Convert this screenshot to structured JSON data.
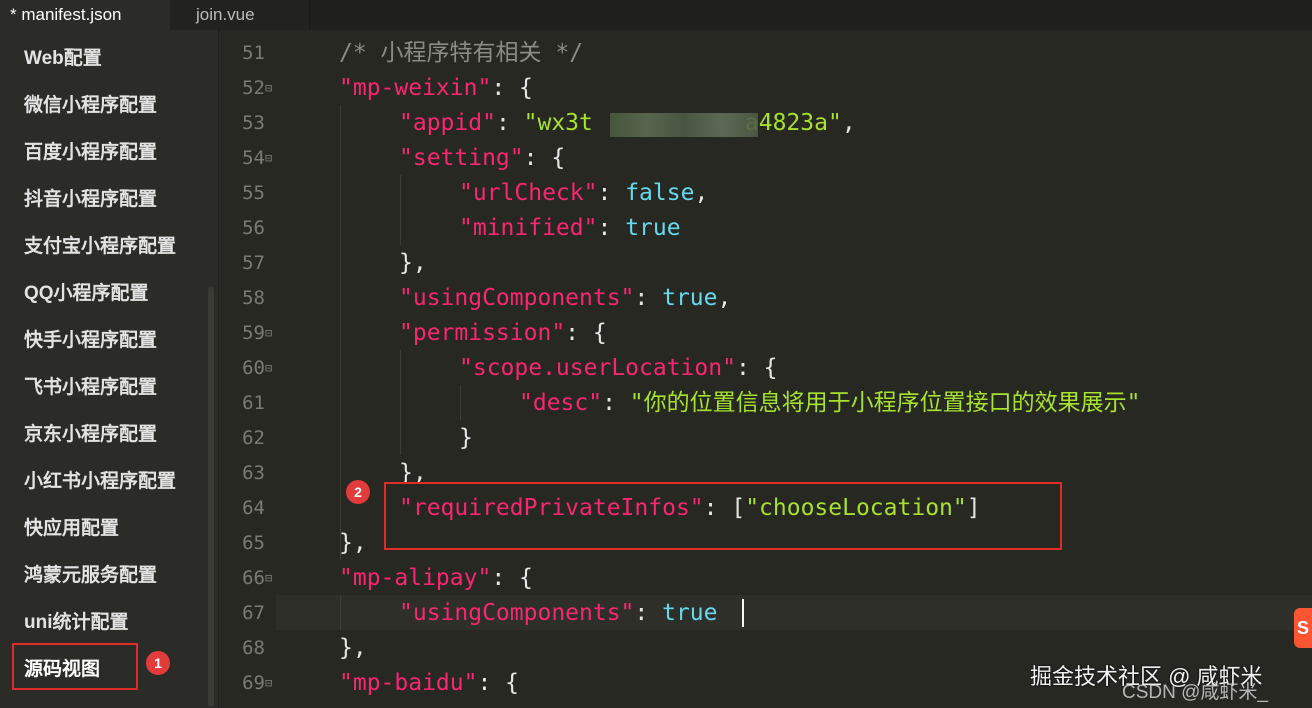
{
  "tabs": [
    {
      "label": "* manifest.json",
      "active": true
    },
    {
      "label": "join.vue",
      "active": false
    }
  ],
  "sidebar": {
    "items": [
      {
        "label": "Web配置"
      },
      {
        "label": "微信小程序配置"
      },
      {
        "label": "百度小程序配置"
      },
      {
        "label": "抖音小程序配置"
      },
      {
        "label": "支付宝小程序配置"
      },
      {
        "label": "QQ小程序配置"
      },
      {
        "label": "快手小程序配置"
      },
      {
        "label": "飞书小程序配置"
      },
      {
        "label": "京东小程序配置"
      },
      {
        "label": "小红书小程序配置"
      },
      {
        "label": "快应用配置"
      },
      {
        "label": "鸿蒙元服务配置"
      },
      {
        "label": "uni统计配置"
      },
      {
        "label": "源码视图"
      }
    ]
  },
  "editor": {
    "lines": [
      {
        "no": "51",
        "fold": ""
      },
      {
        "no": "52",
        "fold": "⊟"
      },
      {
        "no": "53",
        "fold": ""
      },
      {
        "no": "54",
        "fold": "⊟"
      },
      {
        "no": "55",
        "fold": ""
      },
      {
        "no": "56",
        "fold": ""
      },
      {
        "no": "57",
        "fold": ""
      },
      {
        "no": "58",
        "fold": ""
      },
      {
        "no": "59",
        "fold": "⊟"
      },
      {
        "no": "60",
        "fold": "⊟"
      },
      {
        "no": "61",
        "fold": ""
      },
      {
        "no": "62",
        "fold": ""
      },
      {
        "no": "63",
        "fold": ""
      },
      {
        "no": "64",
        "fold": ""
      },
      {
        "no": "65",
        "fold": ""
      },
      {
        "no": "66",
        "fold": "⊟"
      },
      {
        "no": "67",
        "fold": ""
      },
      {
        "no": "68",
        "fold": ""
      },
      {
        "no": "69",
        "fold": "⊟"
      }
    ],
    "tokens": {
      "t51_comment": "/* 小程序特有相关 */",
      "t52_key": "\"mp-weixin\"",
      "t52_rest": ": {",
      "t53_key": "\"appid\"",
      "t53_colon": ": ",
      "t53_val_a": "\"wx3t",
      "t53_val_b": "a4823a\"",
      "t53_comma": ",",
      "t54_key": "\"setting\"",
      "t54_rest": ": {",
      "t55_key": "\"urlCheck\"",
      "t55_colon": ": ",
      "t55_val": "false",
      "t55_comma": ",",
      "t56_key": "\"minified\"",
      "t56_colon": ": ",
      "t56_val": "true",
      "t57_text": "},",
      "t58_key": "\"usingComponents\"",
      "t58_colon": ": ",
      "t58_val": "true",
      "t58_comma": ",",
      "t59_key": "\"permission\"",
      "t59_rest": ": {",
      "t60_key": "\"scope.userLocation\"",
      "t60_rest": ": {",
      "t61_key": "\"desc\"",
      "t61_colon": ": ",
      "t61_val": "\"你的位置信息将用于小程序位置接口的效果展示\"",
      "t62_text": "}",
      "t63_text": "},",
      "t64_key": "\"requiredPrivateInfos\"",
      "t64_colon": ": [",
      "t64_val": "\"chooseLocation\"",
      "t64_close": "]",
      "t65_text": "},",
      "t66_key": "\"mp-alipay\"",
      "t66_rest": ": {",
      "t67_key": "\"usingComponents\"",
      "t67_colon": ": ",
      "t67_val": "true",
      "t68_text": "},",
      "t69_key": "\"mp-baidu\"",
      "t69_rest": ": {"
    }
  },
  "annotations": {
    "badge1": "1",
    "badge2": "2"
  },
  "watermarks": {
    "juejin": "掘金技术社区 @ 咸虾米",
    "csdn": "CSDN @咸虾米_"
  },
  "logo_letter": "S",
  "colors": {
    "background": "#272822",
    "keyword": "#f92672",
    "string": "#a6e22e",
    "constant": "#66d9ef",
    "comment": "#8a8b83",
    "annotation": "#e02b2b"
  }
}
